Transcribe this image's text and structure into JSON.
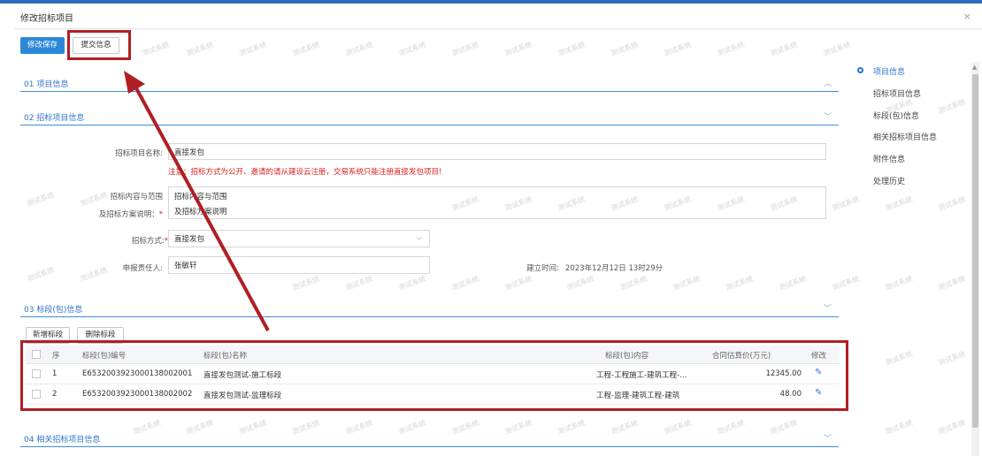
{
  "window": {
    "title": "修改招标项目",
    "close_icon": "×"
  },
  "toolbar": {
    "save_label": "修改保存",
    "submit_label": "提交信息"
  },
  "sections": {
    "s1": "01  项目信息",
    "s2": "02  招标项目信息",
    "s3": "03  标段(包)信息",
    "s4": "04  相关招标项目信息"
  },
  "form": {
    "project_name_label": "招标项目名称:",
    "project_name_value": "直接发包",
    "warning": "注意：招标方式为公开、邀请的请从建设云注册，交易系统只能注册直接发包项目!",
    "scope_label_line1": "招标内容与范围",
    "scope_label_line2": "及招标方案说明：",
    "scope_value_line1": "招标内容与范围",
    "scope_value_line2": "及招标方案说明",
    "method_label": "招标方式:",
    "method_value": "直接发包",
    "owner_label": "申报责任人:",
    "owner_value": "张敏轩",
    "created_label": "建立时间:",
    "created_value": "2023年12月12日 13时29分"
  },
  "lots": {
    "add_label": "新增标段",
    "delete_label": "删除标段",
    "headers": [
      "序",
      "标段(包)编号",
      "标段(包)名称",
      "标段(包)内容",
      "合同估算价(万元)",
      "修改"
    ],
    "rows": [
      {
        "seq": "1",
        "code": "E6532003923000138002001",
        "name": "直接发包测试-施工标段",
        "content": "工程-工程施工-建筑工程-...",
        "price": "12345.00"
      },
      {
        "seq": "2",
        "code": "E6532003923000138002002",
        "name": "直接发包测试-监理标段",
        "content": "工程-监理-建筑工程-建筑",
        "price": "48.00"
      }
    ]
  },
  "right_nav": {
    "items": [
      "项目信息",
      "招标项目信息",
      "标段(包)信息",
      "相关招标项目信息",
      "附件信息",
      "处理历史"
    ]
  },
  "watermark": "测试系统",
  "colors": {
    "primary": "#2b88d8",
    "highlight": "#b01f24",
    "section_blue": "#2d74c9",
    "warning_red": "#d81e1e"
  }
}
